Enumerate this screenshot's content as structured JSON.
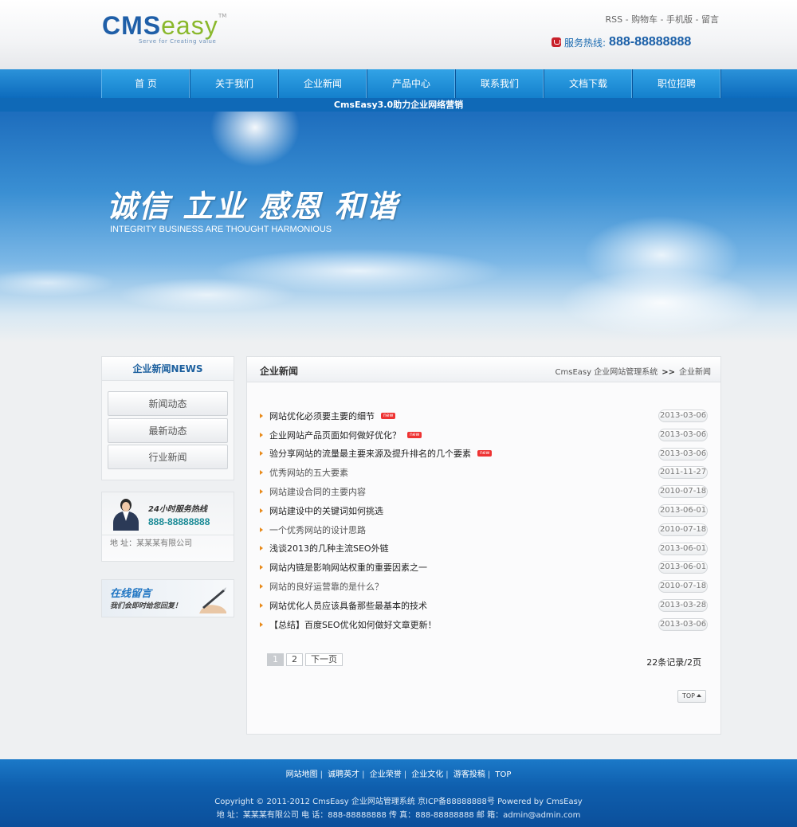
{
  "header": {
    "logo_cms": "CMS",
    "logo_easy": "easy",
    "logo_tm": "TM",
    "logo_tagline": "Serve for Creating value",
    "top_links": [
      "RSS",
      "购物车",
      "手机版",
      "留言"
    ],
    "hotline_label": "服务热线:",
    "hotline_number": "888-88888888"
  },
  "nav": {
    "items": [
      "首 页",
      "关于我们",
      "企业新闻",
      "产品中心",
      "联系我们",
      "文档下载",
      "职位招聘"
    ]
  },
  "subbar_text": "CmsEasy3.0助力企业网络营销",
  "banner": {
    "slogan": "诚信 立业 感恩 和谐",
    "subtitle": "INTEGRITY BUSINESS ARE THOUGHT HARMONIOUS"
  },
  "sidebar": {
    "news_title": "企业新闻NEWS",
    "news_buttons": [
      "新闻动态",
      "最新动态",
      "行业新闻"
    ],
    "contact_label": "24小时服务热线",
    "contact_phone": "888-88888888",
    "contact_address": "地 址：某某某有限公司",
    "message_title": "在线留言",
    "message_sub": "我们会即时给您回复！"
  },
  "main": {
    "title": "企业新闻",
    "breadcrumb_root": "CmsEasy 企业网站管理系统",
    "breadcrumb_sep": ">>",
    "breadcrumb_current": "企业新闻",
    "new_badge": "new",
    "news": [
      {
        "title": "网站优化必须要主要的细节",
        "date": "2013-03-06",
        "is_new": true,
        "gray": false
      },
      {
        "title": "企业网站产品页面如何做好优化？",
        "date": "2013-03-06",
        "is_new": true,
        "gray": false
      },
      {
        "title": "验分享网站的流量最主要来源及提升排名的几个要素",
        "date": "2013-03-06",
        "is_new": true,
        "gray": false
      },
      {
        "title": "优秀网站的五大要素",
        "date": "2011-11-27",
        "is_new": false,
        "gray": true
      },
      {
        "title": "网站建设合同的主要内容",
        "date": "2010-07-18",
        "is_new": false,
        "gray": true
      },
      {
        "title": "网站建设中的关键词如何挑选",
        "date": "2013-06-01",
        "is_new": false,
        "gray": false
      },
      {
        "title": "一个优秀网站的设计思路",
        "date": "2010-07-18",
        "is_new": false,
        "gray": true
      },
      {
        "title": "浅谈2013的几种主流SEO外链",
        "date": "2013-06-01",
        "is_new": false,
        "gray": false
      },
      {
        "title": "网站内链是影响网站权重的重要因素之一",
        "date": "2013-06-01",
        "is_new": false,
        "gray": false
      },
      {
        "title": "网站的良好运营靠的是什么？",
        "date": "2010-07-18",
        "is_new": false,
        "gray": true
      },
      {
        "title": "网站优化人员应该具备那些最基本的技术",
        "date": "2013-03-28",
        "is_new": false,
        "gray": false
      },
      {
        "title": "【总结】百度SEO优化如何做好文章更新！",
        "date": "2013-03-06",
        "is_new": false,
        "gray": false
      }
    ],
    "pager": {
      "pages": [
        "1",
        "2"
      ],
      "next": "下一页",
      "current": "1"
    },
    "record_count": "22条记录/2页",
    "top_button": "TOP"
  },
  "footer": {
    "links": [
      "网站地图",
      "诚聘英才",
      "企业荣誉",
      "企业文化",
      "游客投稿",
      "TOP"
    ],
    "copyright": "Copyright © 2011-2012  CmsEasy 企业网站管理系统  京ICP备88888888号  Powered by CmsEasy",
    "contact": "地 址：某某某有限公司  电 话：888-88888888  传 真：888-88888888  邮 箱：admin@admin.com"
  }
}
